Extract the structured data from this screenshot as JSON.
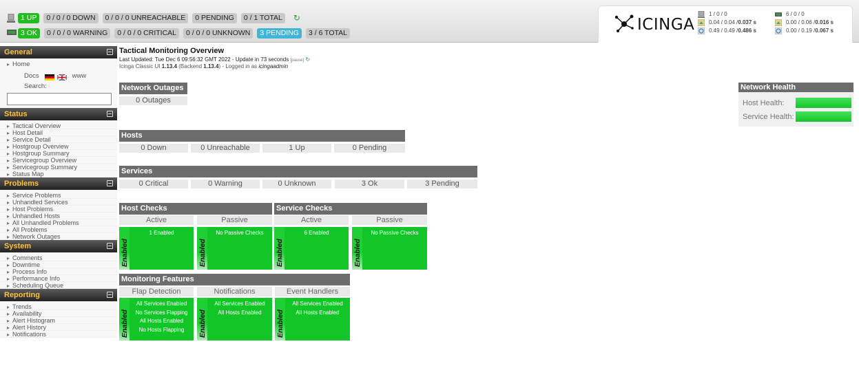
{
  "topbar": {
    "hosts_line": {
      "up": "1 UP",
      "down": "0 / 0 / 0 DOWN",
      "unreachable": "0 / 0 / 0 UNREACHABLE",
      "pending": "0 PENDING",
      "total": "0 / 1 TOTAL"
    },
    "services_line": {
      "ok": "3 OK",
      "warning": "0 / 0 / 0 WARNING",
      "critical": "0 / 0 / 0 CRITICAL",
      "unknown": "0 / 0 / 0 UNKNOWN",
      "pending": "3 PENDING",
      "total": "3 / 6 TOTAL"
    },
    "logo_text": "ICINGA",
    "perf": {
      "host_counts": "1 / 0 / 0",
      "host_lat_a": "0.04 / 0.04 / ",
      "host_lat_b": "0.037 s",
      "host_exec_a": "0.49 / 0.49 / ",
      "host_exec_b": "0.486 s",
      "svc_counts": "6 / 0 / 0",
      "svc_lat_a": "0.00 / 0.06 / ",
      "svc_lat_b": "0.016 s",
      "svc_exec_a": "0.00 / 0.19 / ",
      "svc_exec_b": "0.067 s"
    },
    "colors": {
      "up": "#22bb22",
      "pending": "#3fb6d8",
      "neutral": "#c9c9c9"
    }
  },
  "sidebar": {
    "general": {
      "title": "General",
      "home": "Home",
      "docs": "Docs",
      "www": "www",
      "search_label": "Search:",
      "search_value": ""
    },
    "status": {
      "title": "Status",
      "items": [
        "Tactical Overview",
        "Host Detail",
        "Service Detail",
        "Hostgroup Overview",
        "Hostgroup Summary",
        "Servicegroup Overview",
        "Servicegroup Summary",
        "Status Map"
      ]
    },
    "problems": {
      "title": "Problems",
      "items": [
        "Service Problems",
        "Unhandled Services",
        "Host Problems",
        "Unhandled Hosts",
        "All Unhandled Problems",
        "All Problems",
        "Network Outages"
      ]
    },
    "system": {
      "title": "System",
      "items": [
        "Comments",
        "Downtime",
        "Process Info",
        "Performance Info",
        "Scheduling Queue"
      ]
    },
    "reporting": {
      "title": "Reporting",
      "items": [
        "Trends",
        "Availability",
        "Alert Histogram",
        "Alert History",
        "Notifications"
      ]
    },
    "header_color": "#ffc238"
  },
  "main": {
    "title": "Tactical Monitoring Overview",
    "updated": "Last Updated: Tue Dec 6 09:56:32 GMT 2022 - Update in 73 seconds",
    "pause": "[pause]",
    "version_a": "Icinga Classic UI ",
    "version_b": "1.13.4",
    "version_c": " (Backend ",
    "version_d": "1.13.4",
    "version_e": ") - Logged in as ",
    "version_user": "icingaadmin",
    "network_outages": {
      "title": "Network Outages",
      "value": "0 Outages"
    },
    "hosts": {
      "title": "Hosts",
      "cells": [
        "0 Down",
        "0 Unreachable",
        "1 Up",
        "0 Pending"
      ]
    },
    "services": {
      "title": "Services",
      "cells": [
        "0 Critical",
        "0 Warning",
        "0 Unknown",
        "3 Ok",
        "3 Pending"
      ]
    },
    "host_checks": {
      "title": "Host Checks",
      "active_label": "Active",
      "passive_label": "Passive",
      "active_text": "1 Enabled",
      "passive_text": "No Passive Checks"
    },
    "service_checks": {
      "title": "Service Checks",
      "active_label": "Active",
      "passive_label": "Passive",
      "active_text": "6 Enabled",
      "passive_text": "No Passive Checks"
    },
    "enabled_label": "Enabled",
    "features": {
      "title": "Monitoring Features",
      "flap_label": "Flap Detection",
      "notif_label": "Notifications",
      "event_label": "Event Handlers",
      "flap_lines": [
        "All Services Enabled",
        "No Services Flapping",
        "All Hosts Enabled",
        "No Hosts Flapping"
      ],
      "notif_lines": [
        "All Services Enabled",
        "All Hosts Enabled"
      ],
      "event_lines": [
        "All Services Enabled",
        "All Hosts Enabled"
      ]
    },
    "network_health": {
      "title": "Network Health",
      "host_label": "Host Health:",
      "service_label": "Service Health:",
      "host_health_percent": 100,
      "service_health_percent": 100
    },
    "status_green": "#11c626",
    "header_gray": "#6c6c6c"
  }
}
